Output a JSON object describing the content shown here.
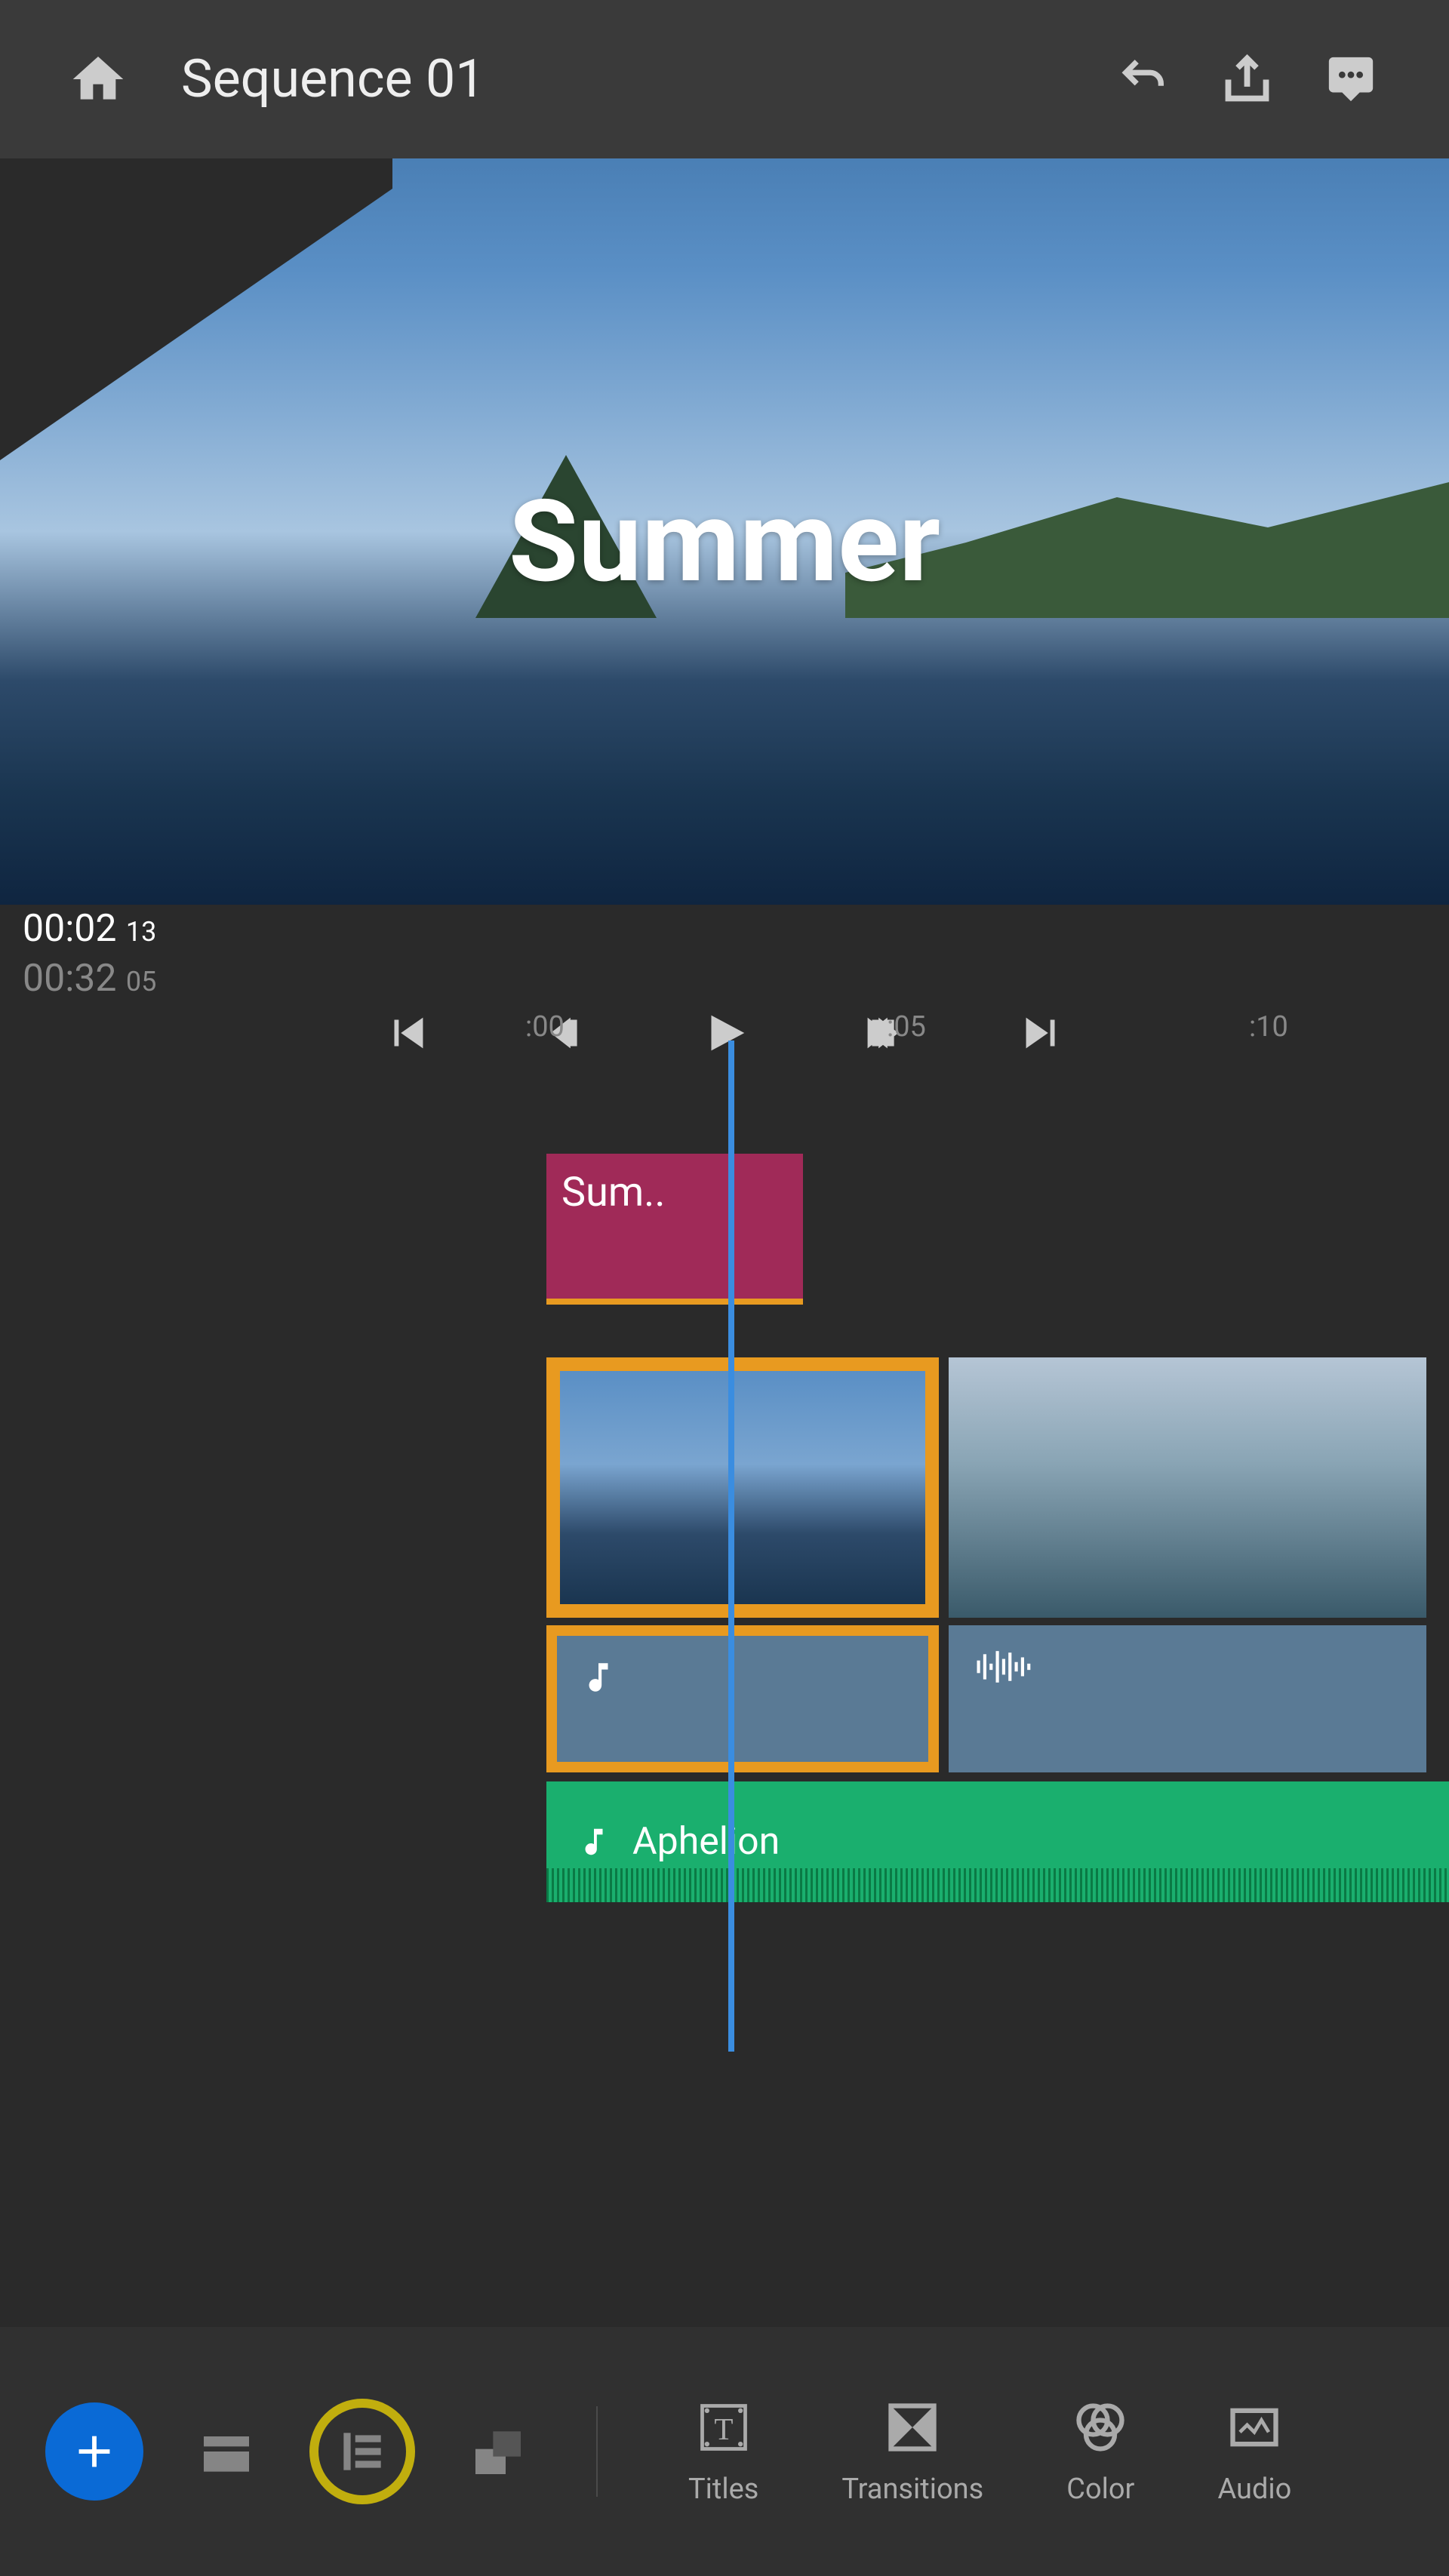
{
  "header": {
    "title": "Sequence 01"
  },
  "preview": {
    "overlay_text": "Summer"
  },
  "timecode": {
    "current": "00:02",
    "current_frames": "13",
    "duration": "00:32",
    "duration_frames": "05"
  },
  "ruler": {
    "marks": [
      ":00",
      ":05",
      ":10"
    ]
  },
  "timeline": {
    "title_clip_label": "Sum..",
    "music_track_label": "Aphelion"
  },
  "bottombar": {
    "tabs": [
      {
        "label": "Titles"
      },
      {
        "label": "Transitions"
      },
      {
        "label": "Color"
      },
      {
        "label": "Audio"
      }
    ]
  },
  "colors": {
    "accent_orange": "#e89a20",
    "accent_blue": "#0a6ad6",
    "highlight_yellow": "#ffe400",
    "title_clip": "#a02a58",
    "music_track": "#1aaf6e",
    "playhead": "#3a8de0"
  }
}
